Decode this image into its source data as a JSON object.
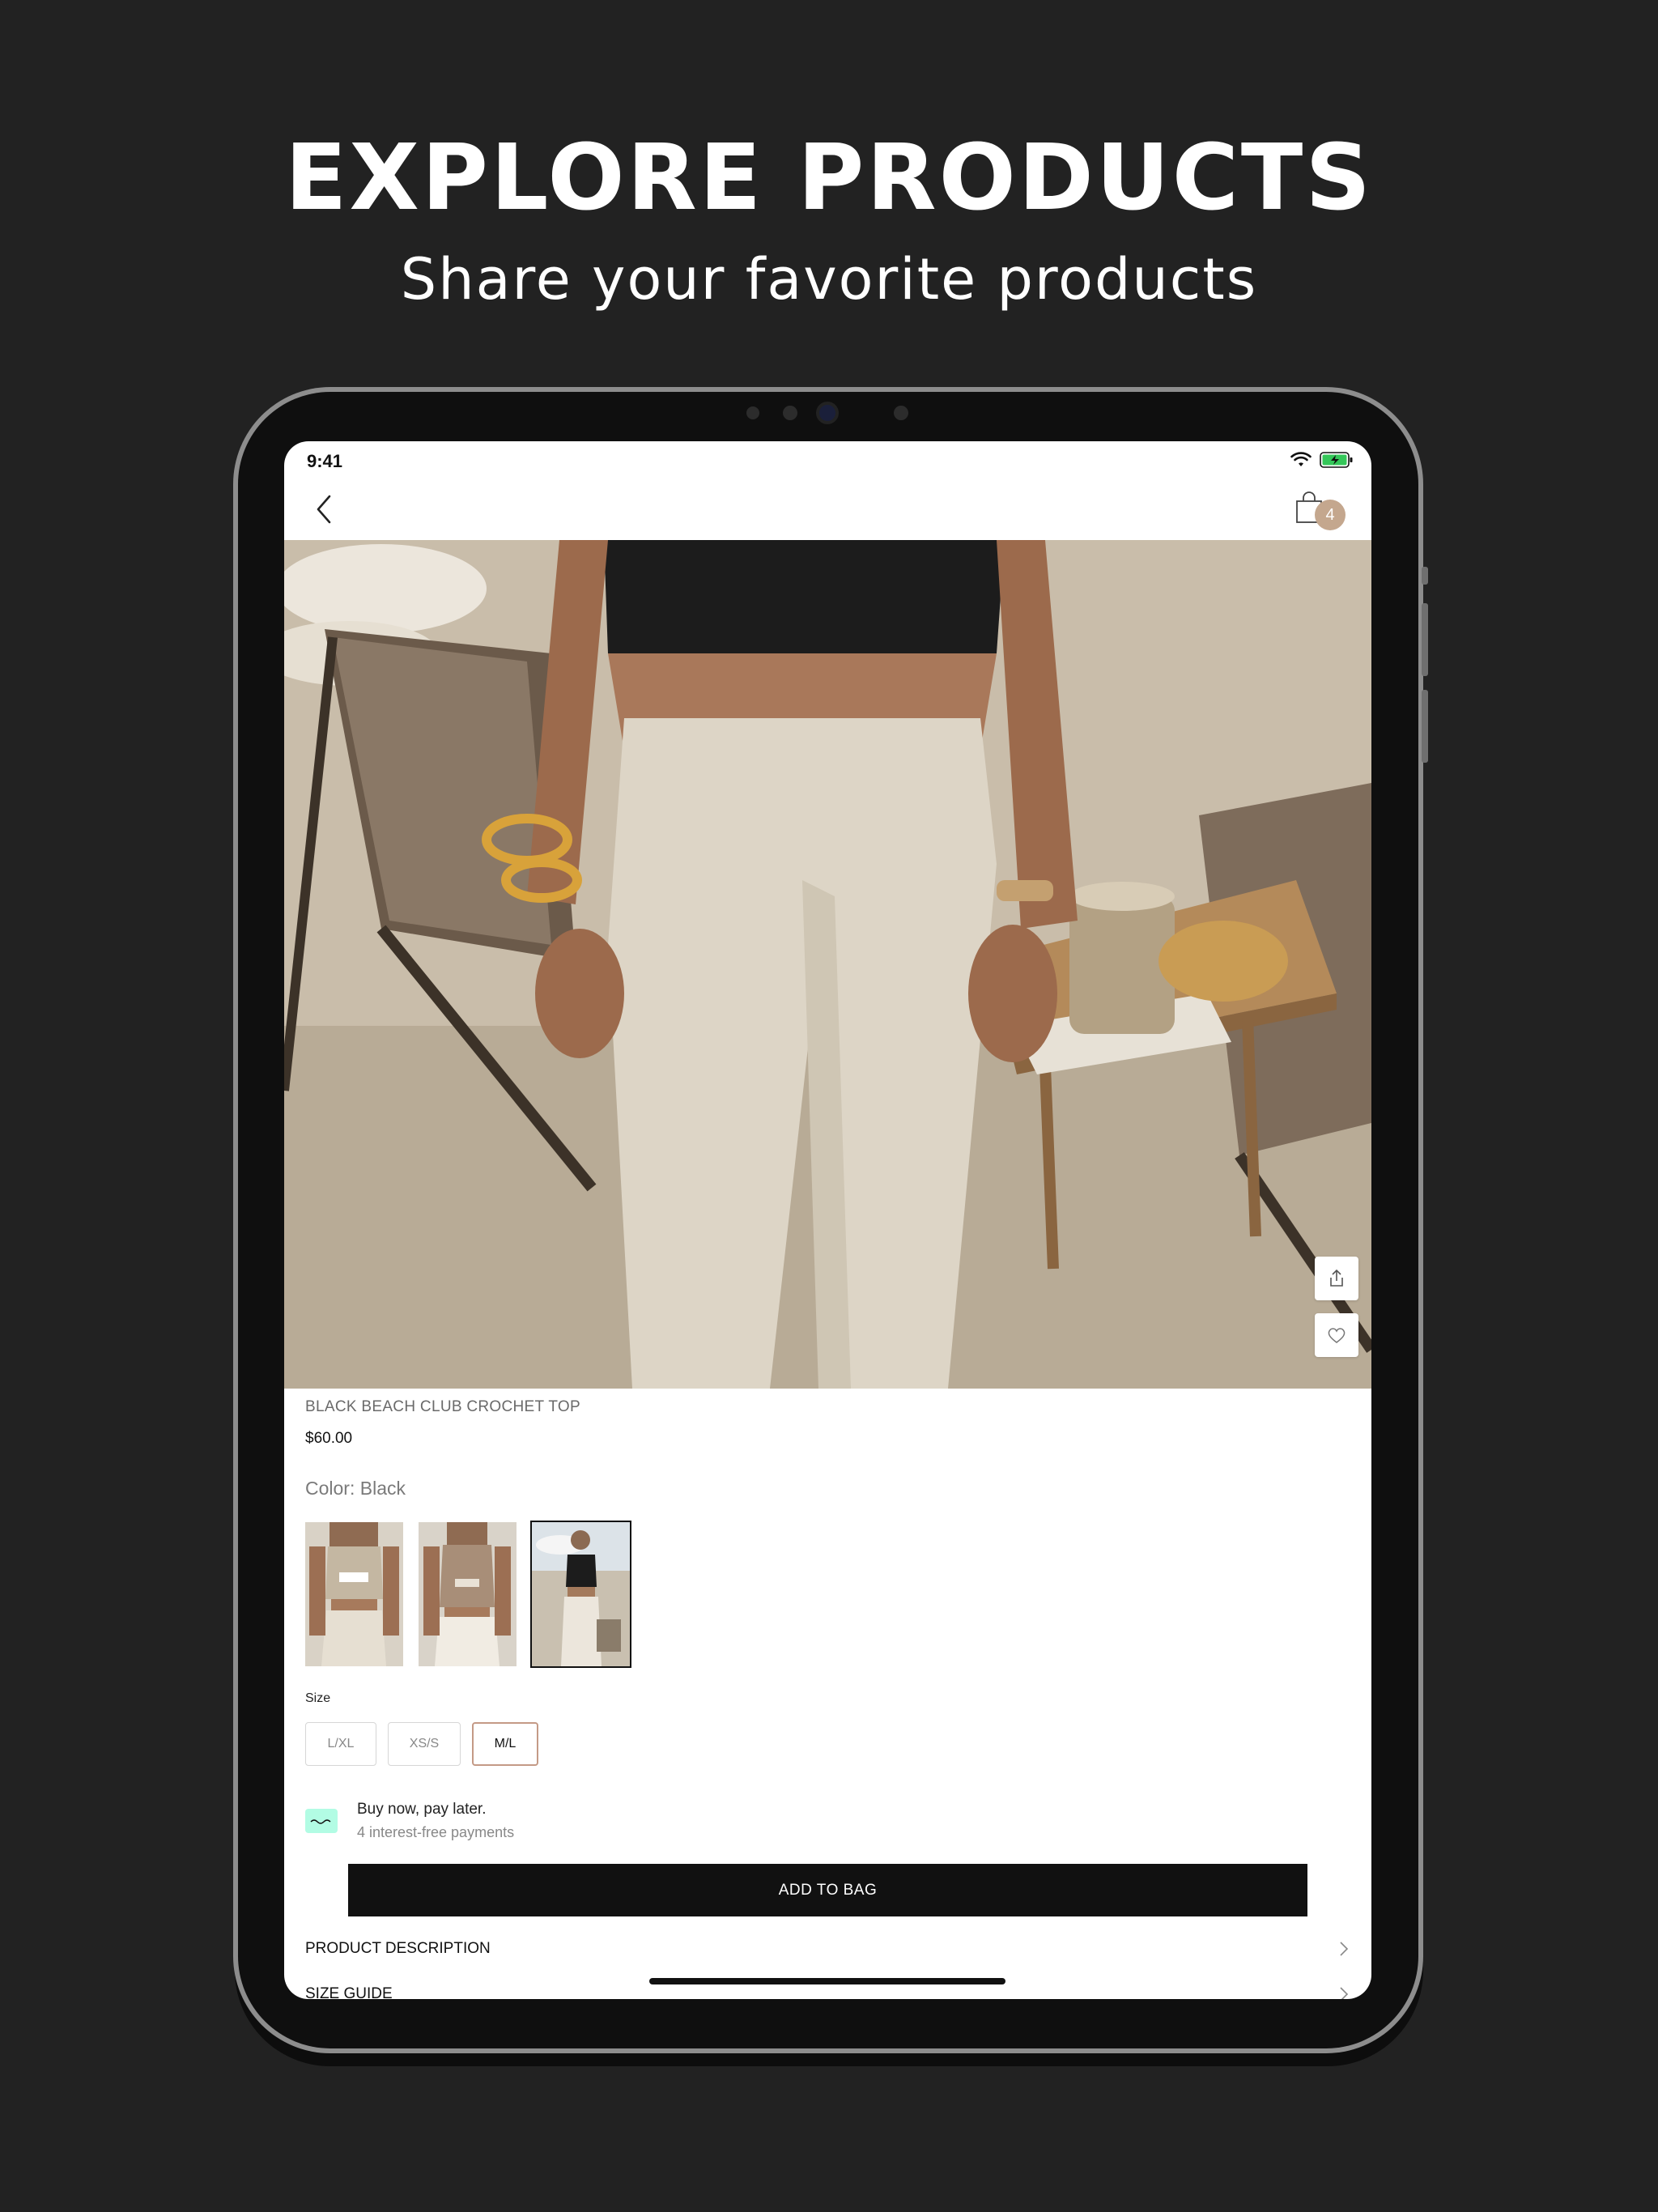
{
  "marketing": {
    "headline": "EXPLORE PRODUCTS",
    "subheadline": "Share your favorite products"
  },
  "status_bar": {
    "time": "9:41",
    "icons": [
      "wifi-icon",
      "battery-charging-icon"
    ]
  },
  "nav": {
    "back_icon": "chevron-left-icon",
    "bag_icon": "shopping-bag-icon",
    "bag_count": "4"
  },
  "hero": {
    "share_icon": "share-icon",
    "wishlist_icon": "heart-icon"
  },
  "product": {
    "title": "BLACK BEACH CLUB CROCHET TOP",
    "price": "$60.00",
    "color_label": "Color: Black",
    "color_swatches": [
      {
        "name": "beige-variant",
        "selected": false
      },
      {
        "name": "taupe-variant",
        "selected": false
      },
      {
        "name": "black-variant",
        "selected": true
      }
    ],
    "size_label": "Size",
    "sizes": [
      {
        "label": "L/XL",
        "selected": false
      },
      {
        "label": "XS/S",
        "selected": false
      },
      {
        "label": "M/L",
        "selected": true
      }
    ]
  },
  "bnpl": {
    "title": "Buy now, pay later.",
    "subtitle": "4 interest-free payments",
    "logo_color": "#b2fce4"
  },
  "actions": {
    "add_to_bag": "ADD TO BAG"
  },
  "sections": [
    {
      "label": "PRODUCT DESCRIPTION"
    },
    {
      "label": "SIZE GUIDE"
    }
  ],
  "colors": {
    "background": "#222222",
    "primary_button": "#111111",
    "badge": "#c4a78e",
    "selected_size_border": "#c49a86"
  }
}
